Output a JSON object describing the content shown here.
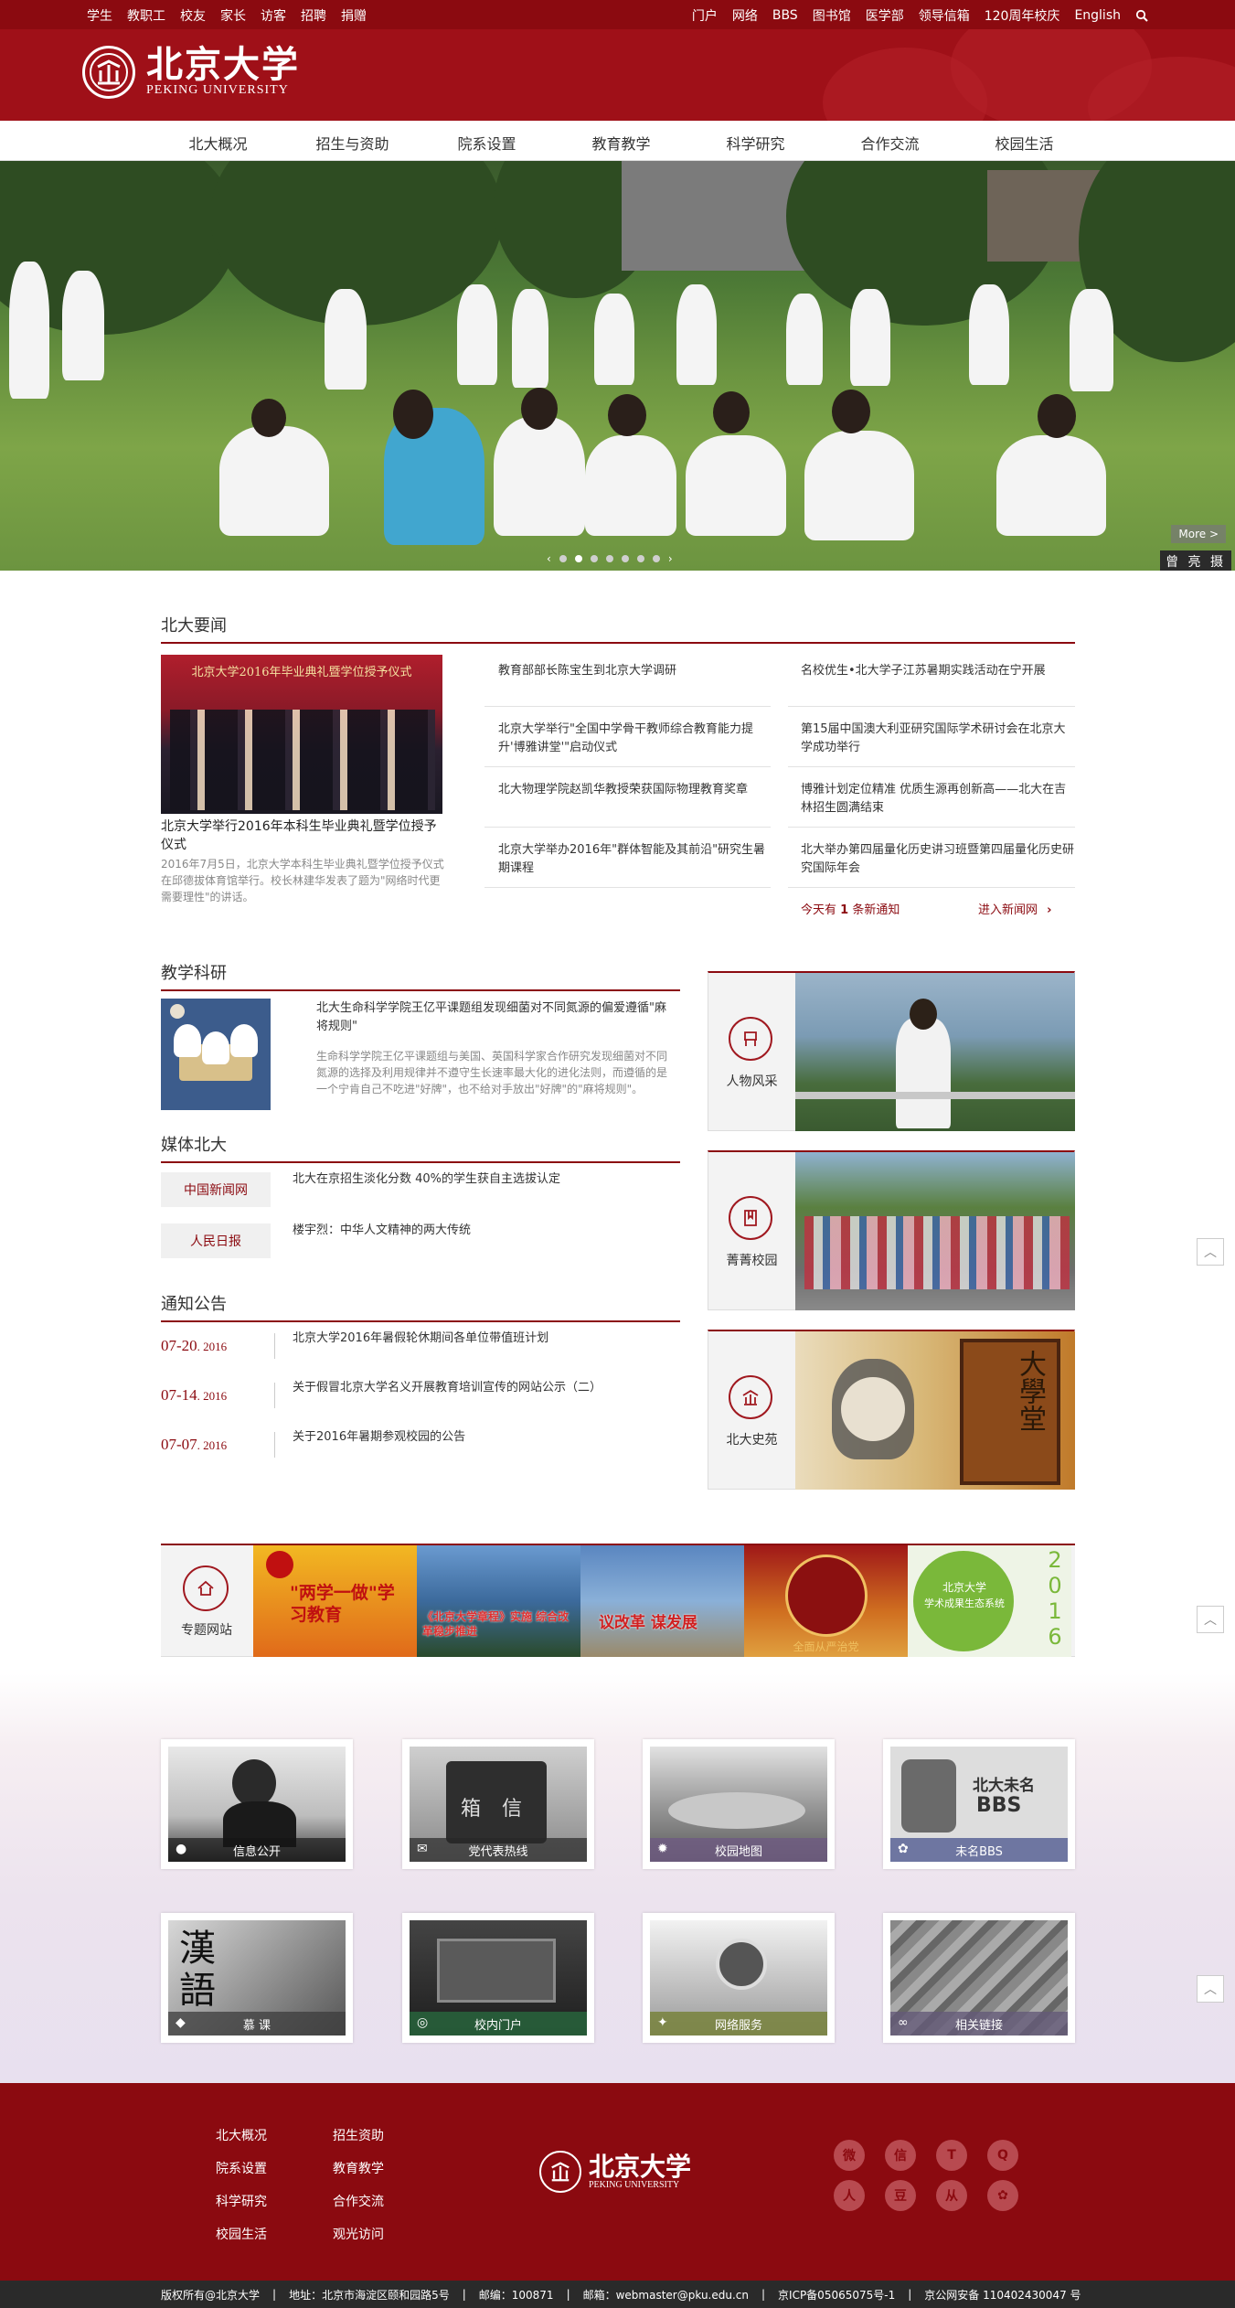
{
  "topbar": {
    "left": [
      "学生",
      "教职工",
      "校友",
      "家长",
      "访客",
      "招聘",
      "捐赠"
    ],
    "right": [
      "门户",
      "网络",
      "BBS",
      "图书馆",
      "医学部",
      "领导信箱",
      "120周年校庆",
      "English"
    ]
  },
  "logo": {
    "cn": "北京大学",
    "en": "PEKING UNIVERSITY"
  },
  "nav": [
    "北大概况",
    "招生与资助",
    "院系设置",
    "教育教学",
    "科学研究",
    "合作交流",
    "校园生活"
  ],
  "banner": {
    "more": "More >",
    "credit": "曾 亮 摄"
  },
  "news": {
    "title": "北大要闻",
    "feature": {
      "headline": "北京大学举行2016年本科生毕业典礼暨学位授予仪式",
      "summary": "2016年7月5日，北京大学本科生毕业典礼暨学位授予仪式在邱德拔体育馆举行。校长林建华发表了题为\"网络时代更需要理性\"的讲话。",
      "photo_caption": "北京大学2016年毕业典礼暨学位授予仪式"
    },
    "col1": [
      "教育部部长陈宝生到北京大学调研",
      "北京大学举行\"全国中学骨干教师综合教育能力提升'博雅讲堂'\"启动仪式",
      "北大物理学院赵凯华教授荣获国际物理教育奖章",
      "北京大学举办2016年\"群体智能及其前沿\"研究生暑期课程"
    ],
    "col2": [
      "名校优生•北大学子江苏暑期实践活动在宁开展",
      "第15届中国澳大利亚研究国际学术研讨会在北京大学成功举行",
      "博雅计划定位精准 优质生源再创新高——北大在吉林招生圆满结束",
      "北大举办第四届量化历史讲习班暨第四届量化历史研究国际年会"
    ],
    "notice_prefix": "今天有",
    "notice_count": "1",
    "notice_suffix": "条新通知",
    "enter": "进入新闻网"
  },
  "research": {
    "title": "教学科研",
    "headline": "北大生命科学学院王亿平课题组发现细菌对不同氮源的偏爱遵循\"麻将规则\"",
    "summary": "生命科学学院王亿平课题组与美国、英国科学家合作研究发现细菌对不同氮源的选择及利用规律并不遵守生长速率最大化的进化法则，而遵循的是一个宁肯自己不吃进\"好牌\"，也不给对手放出\"好牌\"的\"麻将规则\"。"
  },
  "media": {
    "title": "媒体北大",
    "items": [
      {
        "tag": "中国新闻网",
        "text": "北大在京招生淡化分数 40%的学生获自主选拔认定"
      },
      {
        "tag": "人民日报",
        "text": "楼宇烈：中华人文精神的两大传统"
      }
    ]
  },
  "notices": {
    "title": "通知公告",
    "items": [
      {
        "md": "07-20",
        "y": ". 2016",
        "text": "北京大学2016年暑假轮休期间各单位带值班计划"
      },
      {
        "md": "07-14",
        "y": ". 2016",
        "text": "关于假冒北京大学名义开展教育培训宣传的网站公示（二）"
      },
      {
        "md": "07-07",
        "y": ". 2016",
        "text": "关于2016年暑期参观校园的公告"
      }
    ]
  },
  "cards": [
    {
      "label": "人物风采",
      "icon": "chair-icon"
    },
    {
      "label": "菁菁校园",
      "icon": "book-icon"
    },
    {
      "label": "北大史苑",
      "icon": "emblem-icon"
    }
  ],
  "card3_text": "大學堂",
  "topics": {
    "label": "专题网站",
    "t1": "\"两学一做\"学习教育",
    "t2": "《北京大学章程》实施 综合改革稳步推进",
    "t3": "议改革 谋发展",
    "t4": "全面从严治党",
    "t5a": "北京大学",
    "t5b": "学术成果生态系统",
    "t5c": "2016"
  },
  "services": [
    {
      "label": "信息公开"
    },
    {
      "label": "党代表热线"
    },
    {
      "label": "校园地图"
    },
    {
      "label": "未名BBS"
    },
    {
      "label": "慕    课"
    },
    {
      "label": "校内门户"
    },
    {
      "label": "网络服务"
    },
    {
      "label": "相关链接"
    }
  ],
  "svc_text": {
    "bbs1": "北大未名",
    "bbs2": "BBS",
    "ballot": "箱 信",
    "han": "漢語"
  },
  "footer": {
    "col1": [
      "北大概况",
      "院系设置",
      "科学研究",
      "校园生活"
    ],
    "col2": [
      "招生资助",
      "教育教学",
      "合作交流",
      "观光访问"
    ],
    "logo_cn": "北京大学",
    "logo_en": "PEKING UNIVERSITY",
    "social": [
      "微",
      "信",
      "T",
      "Q",
      "人",
      "豆",
      "从",
      "✿"
    ]
  },
  "copyright": [
    "版权所有@北京大学",
    "|",
    "地址：北京市海淀区颐和园路5号",
    "|",
    "邮编：100871",
    "|",
    "邮箱：webmaster@pku.edu.cn",
    "|",
    "京ICP备05065075号-1",
    "|",
    "京公网安备 110402430047 号"
  ],
  "colors": {
    "brand": "#8b0a10",
    "accent": "#a0181f"
  }
}
